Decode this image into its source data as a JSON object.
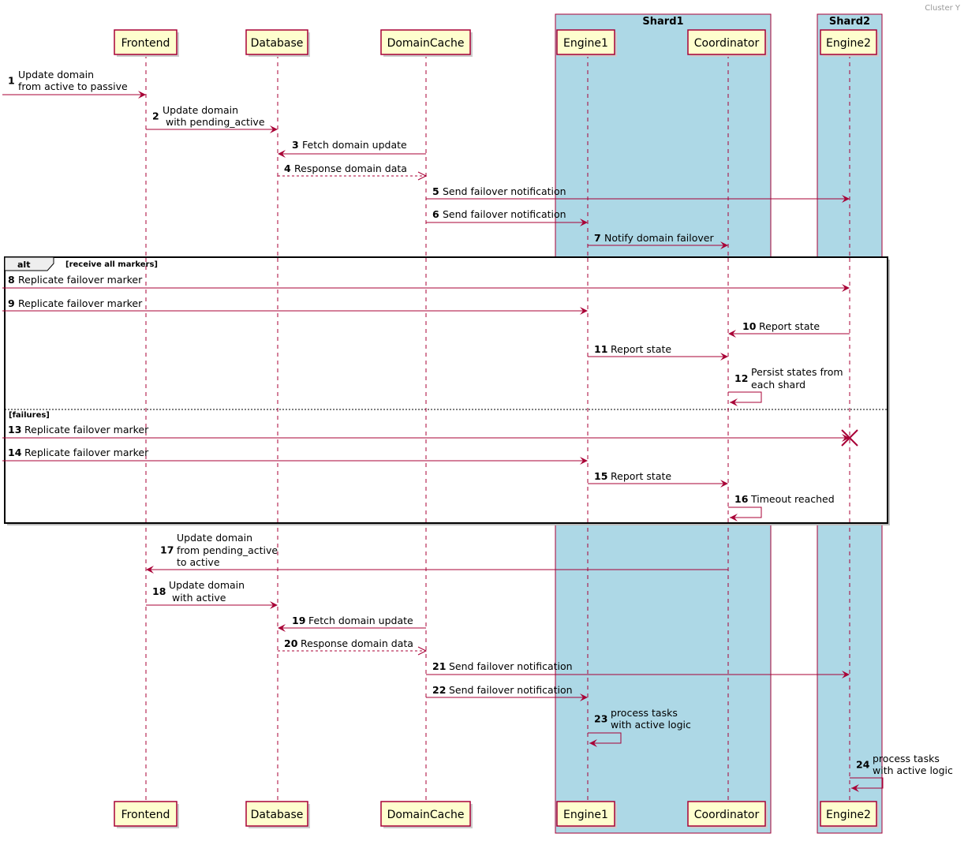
{
  "header": {
    "cluster_label": "Cluster Y"
  },
  "colors": {
    "arrow": "#A80036",
    "participant_fill": "#FEFECE",
    "participant_border": "#A80036",
    "box_fill": "#ADD8E6"
  },
  "boxes": [
    {
      "id": "shard1",
      "title": "Shard1"
    },
    {
      "id": "shard2",
      "title": "Shard2"
    }
  ],
  "participants": [
    {
      "id": "F",
      "name": "Frontend"
    },
    {
      "id": "D",
      "name": "Database"
    },
    {
      "id": "DC",
      "name": "DomainCache"
    },
    {
      "id": "E1",
      "name": "Engine1",
      "box": "shard1"
    },
    {
      "id": "C",
      "name": "Coordinator",
      "box": "shard1"
    },
    {
      "id": "E2",
      "name": "Engine2",
      "box": "shard2"
    }
  ],
  "alt": {
    "keyword": "alt",
    "branches": [
      {
        "condition": "[receive all markers]"
      },
      {
        "condition": "[failures]"
      }
    ]
  },
  "messages": [
    {
      "n": "1",
      "from": "in",
      "to": "F",
      "lines": [
        "Update domain",
        "from active to passive"
      ]
    },
    {
      "n": "2",
      "from": "F",
      "to": "D",
      "lines": [
        "Update domain",
        " with pending_active"
      ]
    },
    {
      "n": "3",
      "from": "DC",
      "to": "D",
      "lines": [
        "Fetch domain update"
      ]
    },
    {
      "n": "4",
      "from": "D",
      "to": "DC",
      "dashed": true,
      "lines": [
        "Response domain data"
      ]
    },
    {
      "n": "5",
      "from": "DC",
      "to": "E2",
      "lines": [
        "Send failover notification"
      ]
    },
    {
      "n": "6",
      "from": "DC",
      "to": "E1",
      "lines": [
        "Send failover notification"
      ]
    },
    {
      "n": "7",
      "from": "E1",
      "to": "C",
      "lines": [
        "Notify domain failover"
      ]
    },
    {
      "n": "8",
      "from": "in",
      "to": "E2",
      "lines": [
        "Replicate failover marker"
      ]
    },
    {
      "n": "9",
      "from": "in",
      "to": "E1",
      "lines": [
        "Replicate failover marker"
      ]
    },
    {
      "n": "10",
      "from": "E2",
      "to": "C",
      "lines": [
        "Report state"
      ]
    },
    {
      "n": "11",
      "from": "E1",
      "to": "C",
      "lines": [
        "Report state"
      ]
    },
    {
      "n": "12",
      "from": "C",
      "to": "C",
      "lines": [
        "Persist states from",
        "each shard"
      ]
    },
    {
      "n": "13",
      "from": "in",
      "to": "E2",
      "destroy": true,
      "lines": [
        "Replicate failover marker"
      ]
    },
    {
      "n": "14",
      "from": "in",
      "to": "E1",
      "lines": [
        "Replicate failover marker"
      ]
    },
    {
      "n": "15",
      "from": "E1",
      "to": "C",
      "lines": [
        "Report state"
      ]
    },
    {
      "n": "16",
      "from": "C",
      "to": "C",
      "lines": [
        "Timeout reached"
      ]
    },
    {
      "n": "17",
      "from": "C",
      "to": "F",
      "lines": [
        "Update domain",
        "from pending_active",
        "to active"
      ]
    },
    {
      "n": "18",
      "from": "F",
      "to": "D",
      "lines": [
        "Update domain",
        " with active"
      ]
    },
    {
      "n": "19",
      "from": "DC",
      "to": "D",
      "lines": [
        "Fetch domain update"
      ]
    },
    {
      "n": "20",
      "from": "D",
      "to": "DC",
      "dashed": true,
      "lines": [
        "Response domain data"
      ]
    },
    {
      "n": "21",
      "from": "DC",
      "to": "E2",
      "lines": [
        "Send failover notification"
      ]
    },
    {
      "n": "22",
      "from": "DC",
      "to": "E1",
      "lines": [
        "Send failover notification"
      ]
    },
    {
      "n": "23",
      "from": "E1",
      "to": "E1",
      "lines": [
        "process tasks",
        "with active logic"
      ]
    },
    {
      "n": "24",
      "from": "E2",
      "to": "E2",
      "lines": [
        "process tasks",
        "with active logic"
      ]
    }
  ]
}
